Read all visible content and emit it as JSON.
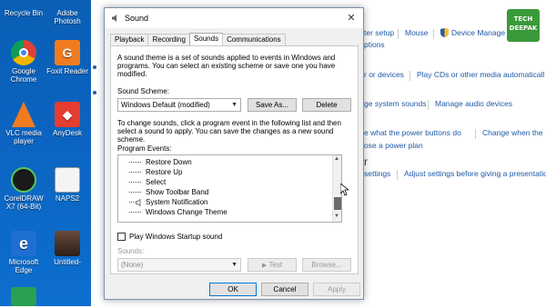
{
  "desktop": {
    "icons": [
      {
        "label": "Recycle Bin"
      },
      {
        "label": "Adobe Photosh"
      },
      {
        "label": "Google Chrome"
      },
      {
        "label": "Foxit Reader"
      },
      {
        "label": "VLC media player"
      },
      {
        "label": "AnyDesk"
      },
      {
        "label": "CorelDRAW X7 (64-Bit)"
      },
      {
        "label": "NAPS2"
      },
      {
        "label": "Microsoft Edge"
      },
      {
        "label": "Untitled-"
      }
    ]
  },
  "control_panel": {
    "links": [
      "ter setup",
      "Mouse",
      "Device Manage",
      "ptions",
      "r or devices",
      "Play CDs or other media automaticall",
      "ge system sounds",
      "Manage audio devices",
      "e what the power buttons do",
      "Change when the",
      "ose a power plan",
      "settings",
      "Adjust settings before giving a presentatio"
    ],
    "headings": [
      "r"
    ],
    "logo": "TECH\nDEEPAK"
  },
  "dialog": {
    "title": "Sound",
    "close": "✕",
    "tabs": [
      "Playback",
      "Recording",
      "Sounds",
      "Communications"
    ],
    "active_tab": "Sounds",
    "theme_desc": "A sound theme is a set of sounds applied to events in Windows and programs.  You can select an existing scheme or save one you have modified.",
    "scheme_label": "Sound Scheme:",
    "scheme_value": "Windows Default (modified)",
    "save_as": "Save As...",
    "delete": "Delete",
    "change_desc": "To change sounds, click a program event in the following list and then select a sound to apply.  You can save the changes as a new sound scheme.",
    "events_label": "Program Events:",
    "events": [
      {
        "label": "Restore Down",
        "has_sound": false
      },
      {
        "label": "Restore Up",
        "has_sound": false
      },
      {
        "label": "Select",
        "has_sound": false
      },
      {
        "label": "Show Toolbar Band",
        "has_sound": false
      },
      {
        "label": "System Notification",
        "has_sound": true
      },
      {
        "label": "Windows Change Theme",
        "has_sound": false
      }
    ],
    "startup_label": "Play Windows Startup sound",
    "sounds_label": "Sounds:",
    "sounds_value": "(None)",
    "test": "Test",
    "browse": "Browse...",
    "ok": "OK",
    "cancel": "Cancel",
    "apply": "Apply"
  }
}
